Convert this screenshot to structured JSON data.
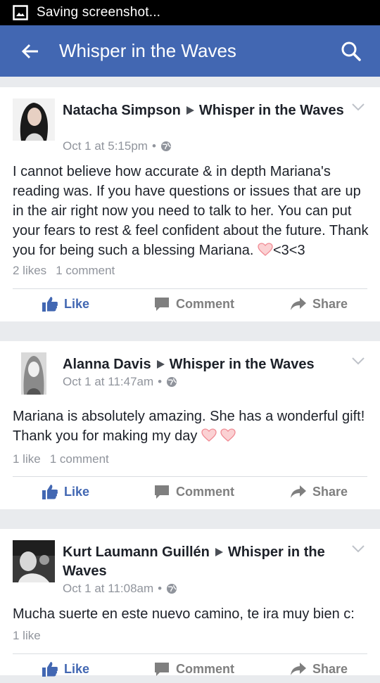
{
  "status_bar": {
    "text": "Saving screenshot..."
  },
  "app_bar": {
    "title": "Whisper in the Waves"
  },
  "actions": {
    "like": "Like",
    "comment": "Comment",
    "share": "Share"
  },
  "posts": [
    {
      "author": "Natacha Simpson",
      "target": "Whisper in the Waves",
      "time": "Oct 1 at 5:15pm",
      "text": "I cannot believe how accurate & in depth Mariana's reading was. If you have questions or issues that are up in the air right now you need to talk to her. You can put your fears to rest & feel confident about the future. Thank you for being such a blessing Mariana.",
      "text_suffix": "<3<3",
      "likes": "2 likes",
      "comments": "1 comment"
    },
    {
      "author": "Alanna Davis",
      "target": "Whisper in the Waves",
      "time": "Oct 1 at 11:47am",
      "text": "Mariana is absolutely amazing. She has a wonderful gift! Thank you for making my day",
      "likes": "1 like",
      "comments": "1 comment"
    },
    {
      "author": "Kurt Laumann Guillén",
      "target": "Whisper in the Waves",
      "time": "Oct 1 at 11:08am",
      "text": "Mucha suerte en este nuevo camino, te ira muy bien c:",
      "likes": "1 like"
    }
  ],
  "colors": {
    "brand": "#4267b2",
    "meta": "#90949c",
    "heart": "#f4a3a8"
  }
}
